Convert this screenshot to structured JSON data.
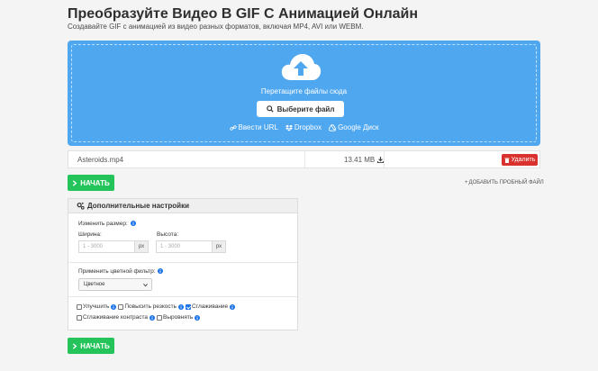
{
  "header": {
    "title": "Преобразуйте Видео В GIF С Анимацией Онлайн",
    "subtitle": "Создавайте GIF с анимацией из видео разных форматов, включая MP4, AVI или WEBM."
  },
  "dropzone": {
    "drop_text": "Перетащите файлы сюда",
    "choose_label": "Выберите файл",
    "sources": [
      "Ввести URL",
      "Dropbox",
      "Google Диск"
    ],
    "accent": "#4fa7f0"
  },
  "file": {
    "name": "Asteroids.mp4",
    "size": "13.41 MB",
    "delete_label": "Удалить"
  },
  "actions": {
    "start_label": "НАЧАТЬ",
    "sample_label": "ДОБАВИТЬ ПРОБНЫЙ ФАЙЛ",
    "start_color": "#24c45b"
  },
  "settings": {
    "title": "Дополнительные настройки",
    "resize_label": "Изменить размер:",
    "width_label": "Ширина:",
    "height_label": "Высота:",
    "width_placeholder": "1 - 3000",
    "height_placeholder": "1 - 3000",
    "unit": "px",
    "filter_label": "Применить цветной фильтр:",
    "filter_value": "Цветное",
    "options": [
      {
        "label": "Улучшить",
        "checked": false
      },
      {
        "label": "Повысить резкость",
        "checked": false
      },
      {
        "label": "Сглаживание",
        "checked": true
      },
      {
        "label": "Сглаживание контраста",
        "checked": false
      },
      {
        "label": "Выровнять",
        "checked": false
      }
    ]
  }
}
